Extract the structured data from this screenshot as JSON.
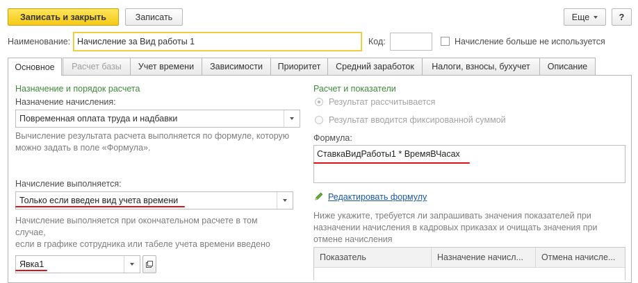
{
  "toolbar": {
    "save_close_label": "Записать и закрыть",
    "save_label": "Записать",
    "more_label": "Еще",
    "help_label": "?"
  },
  "header": {
    "name_label": "Наименование:",
    "name_value": "Начисление за Вид работы 1",
    "code_label": "Код:",
    "code_value": "",
    "unused_label": "Начисление больше не используется",
    "unused_checked": false
  },
  "tabs": [
    {
      "label": "Основное",
      "active": true,
      "disabled": false
    },
    {
      "label": "Расчет базы",
      "active": false,
      "disabled": true
    },
    {
      "label": "Учет времени",
      "active": false,
      "disabled": false
    },
    {
      "label": "Зависимости",
      "active": false,
      "disabled": false
    },
    {
      "label": "Приоритет",
      "active": false,
      "disabled": false
    },
    {
      "label": "Средний заработок",
      "active": false,
      "disabled": false
    },
    {
      "label": "Налоги, взносы, бухучет",
      "active": false,
      "disabled": false
    },
    {
      "label": "Описание",
      "active": false,
      "disabled": false
    }
  ],
  "left": {
    "section_title": "Назначение и порядок расчета",
    "purpose_label": "Назначение начисления:",
    "purpose_value": "Повременная оплата труда и надбавки",
    "formula_hint": "Вычисление результата расчета выполняется по формуле, которую можно задать в поле «Формула».",
    "execution_label": "Начисление выполняется:",
    "execution_value": "Только если введен вид учета времени",
    "execution_hint_1": "Начисление выполняется при окончательном расчете в том случае,",
    "execution_hint_2": "если в графике сотрудника или табеле учета времени введено",
    "time_type_value": "Явка1"
  },
  "right": {
    "section_title": "Расчет и показатели",
    "radio_calculated": "Результат рассчитывается",
    "radio_fixed": "Результат вводится фиксированной суммой",
    "formula_label": "Формула:",
    "formula_value": "СтавкаВидРаботы1 * ВремяВЧасах",
    "edit_formula_link": "Редактировать формулу",
    "indicators_hint": "Ниже укажите, требуется ли запрашивать значения показателей при назначении начисления в кадровых приказах и очищать значения при отмене начисления",
    "table_headers": [
      "Показатель",
      "Назначение начисл...",
      "Отмена начисле..."
    ]
  },
  "colors": {
    "primary_button": "#f6c915",
    "section_title": "#3e8b3a",
    "highlight_border": "#f0c419",
    "annotation_underline": "#d8131b",
    "link": "#1b57a6"
  },
  "icons": {
    "dropdown": "chevron-down-icon",
    "open": "open-form-icon",
    "edit": "pencil-icon"
  }
}
